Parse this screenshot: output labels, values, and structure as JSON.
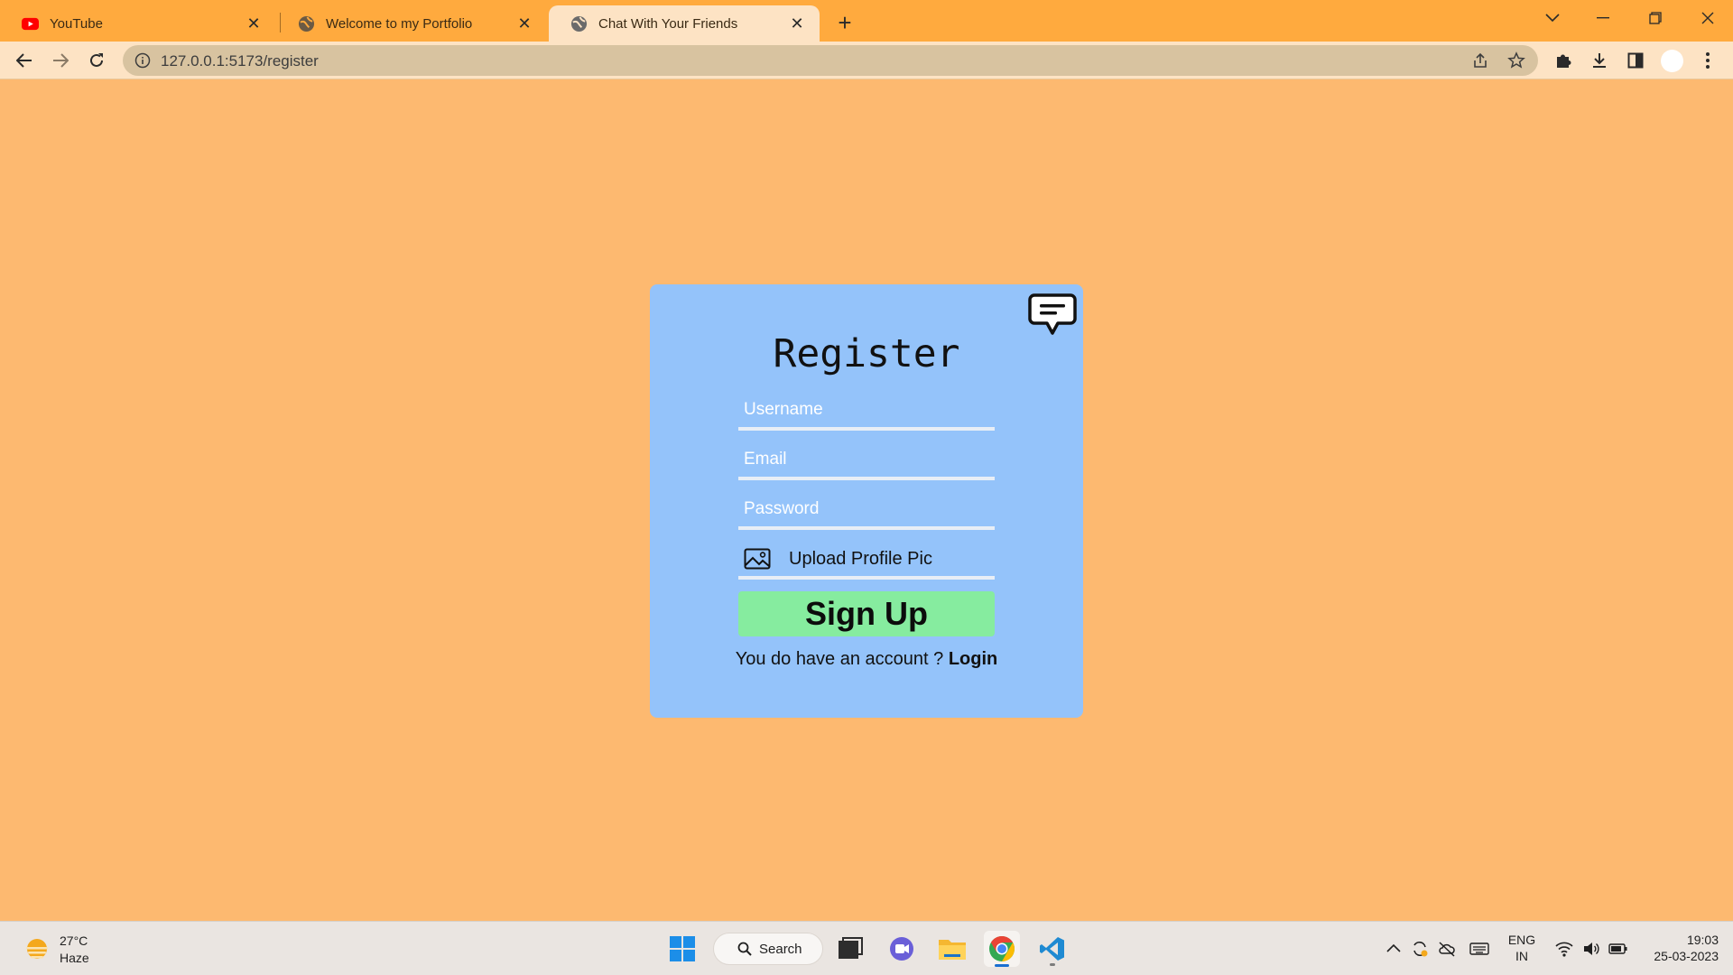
{
  "browser": {
    "tabs": [
      {
        "title": "YouTube",
        "favicon": "youtube-icon"
      },
      {
        "title": "Welcome to my Portfolio",
        "favicon": "globe-icon"
      },
      {
        "title": "Chat With Your Friends",
        "favicon": "globe-icon",
        "active": true
      }
    ],
    "url": "127.0.0.1:5173/register"
  },
  "form": {
    "title": "Register",
    "username_placeholder": "Username",
    "email_placeholder": "Email",
    "password_placeholder": "Password",
    "upload_label": "Upload Profile Pic",
    "submit_label": "Sign Up",
    "account_prompt": "You do have an account ?",
    "login_link": "Login"
  },
  "taskbar": {
    "weather_temp": "27°C",
    "weather_desc": "Haze",
    "search_label": "Search",
    "language": "ENG",
    "region": "IN",
    "time": "19:03",
    "date": "25-03-2023"
  },
  "colors": {
    "page_background": "#fdb970",
    "card_background": "#94c3fa",
    "signup_button": "#86ec9f",
    "tab_strip": "#ffaa3e"
  }
}
